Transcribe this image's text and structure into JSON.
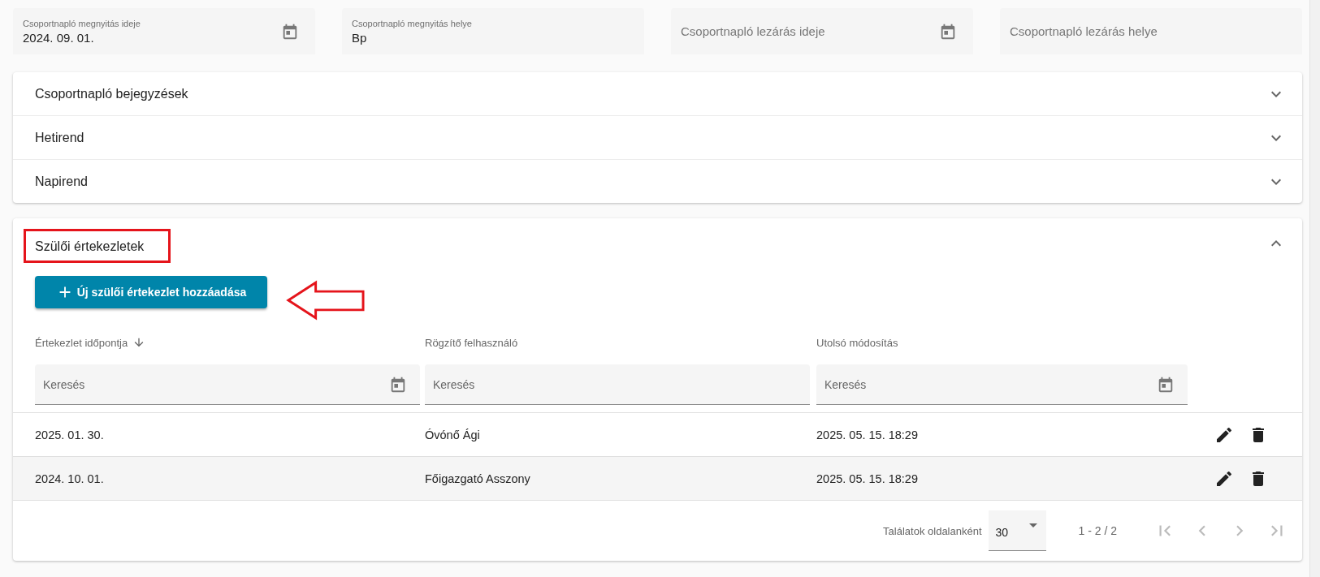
{
  "top_fields": [
    {
      "label": "Csoportnapló megnyitás ideje",
      "value": "2024. 09. 01.",
      "kind": "date"
    },
    {
      "label": "Csoportnapló megnyitás helye",
      "value": "Bp",
      "kind": "text"
    },
    {
      "label": "Csoportnapló lezárás ideje",
      "kind": "date"
    },
    {
      "label": "Csoportnapló lezárás helye",
      "kind": "text"
    }
  ],
  "panels": [
    {
      "title": "Csoportnapló bejegyzések",
      "expanded": false
    },
    {
      "title": "Hetirend",
      "expanded": false
    },
    {
      "title": "Napirend",
      "expanded": false
    }
  ],
  "meetings": {
    "title": "Szülői értekezletek",
    "expanded": true,
    "add_button": "Új szülői értekezlet hozzáadása",
    "columns": [
      {
        "label": "Értekezlet időpontja",
        "sorted_descending": true,
        "filter_placeholder": "Keresés",
        "date_filter": true
      },
      {
        "label": "Rögzítő felhasználó",
        "sorted_descending": false,
        "filter_placeholder": "Keresés",
        "date_filter": false
      },
      {
        "label": "Utolsó módosítás",
        "sorted_descending": false,
        "filter_placeholder": "Keresés",
        "date_filter": true
      }
    ],
    "rows": [
      {
        "cells": [
          "2025. 01. 30.",
          "Óvónő Ági",
          "2025. 05. 15. 18:29"
        ],
        "hovered": false
      },
      {
        "cells": [
          "2024. 10. 01.",
          "Főigazgató Asszony",
          "2025. 05. 15. 18:29"
        ],
        "hovered": true
      }
    ],
    "paginator": {
      "label": "Találatok oldalanként",
      "page_size": "30",
      "range": "1 - 2 / 2",
      "nav_buttons": [
        {
          "kind": "first",
          "disabled": true
        },
        {
          "kind": "prev",
          "disabled": true
        },
        {
          "kind": "next",
          "disabled": true
        },
        {
          "kind": "last",
          "disabled": true
        }
      ]
    }
  }
}
